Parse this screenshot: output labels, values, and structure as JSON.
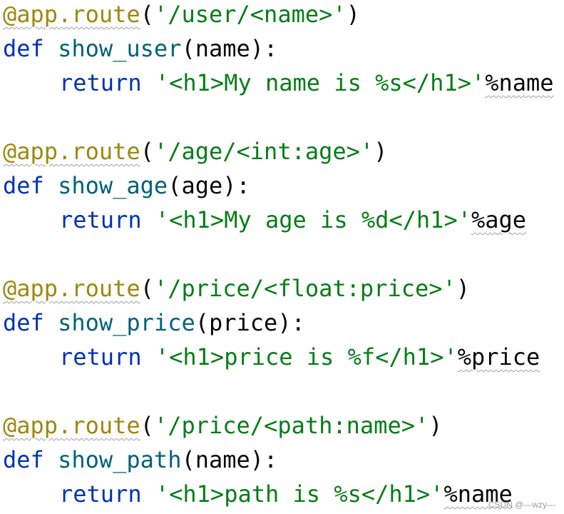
{
  "code": {
    "lines": [
      {
        "decorator": "@app.route",
        "open": "(",
        "string": "'/user/<name>'",
        "close": ")"
      },
      {
        "keyword": "def",
        "func": "show_user",
        "params": "(name):"
      },
      {
        "keyword": "return",
        "string": "'<h1>My name is %s</h1>'",
        "op": "%name"
      },
      {
        "decorator": "@app.route",
        "open": "(",
        "string": "'/age/<int:age>'",
        "close": ")"
      },
      {
        "keyword": "def",
        "func": "show_age",
        "params": "(age):"
      },
      {
        "keyword": "return",
        "string": "'<h1>My age is %d</h1>'",
        "op": "%age"
      },
      {
        "decorator": "@app.route",
        "open": "(",
        "string": "'/price/<float:price>'",
        "close": ")"
      },
      {
        "keyword": "def",
        "func": "show_price",
        "params": "(price):"
      },
      {
        "keyword": "return",
        "string": "'<h1>price is %f</h1>'",
        "op": "%price"
      },
      {
        "decorator": "@app.route",
        "open": "(",
        "string": "'/price/<path:name>'",
        "close": ")"
      },
      {
        "keyword": "def",
        "func": "show_path",
        "params": "(name):"
      },
      {
        "keyword": "return",
        "string": "'<h1>path is %s</h1>'",
        "op": "%name"
      }
    ]
  },
  "watermark": "CSDN @---wzy---",
  "colors": {
    "decorator": "#9e880d",
    "keyword": "#0033b3",
    "function": "#00627a",
    "string": "#067d17",
    "text": "#080808"
  }
}
